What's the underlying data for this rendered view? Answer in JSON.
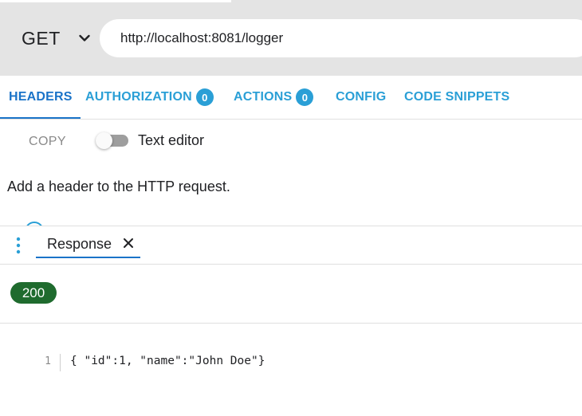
{
  "request": {
    "method": "GET",
    "url": "http://localhost:8081/logger"
  },
  "tabs": [
    {
      "label": "HEADERS",
      "active": true
    },
    {
      "label": "AUTHORIZATION",
      "badge": "0"
    },
    {
      "label": "ACTIONS",
      "badge": "0"
    },
    {
      "label": "CONFIG"
    },
    {
      "label": "CODE SNIPPETS"
    }
  ],
  "headers_panel": {
    "copy_label": "COPY",
    "text_editor_label": "Text editor",
    "text_editor_on": false,
    "hint": "Add a header to the HTTP request."
  },
  "response": {
    "tab_label": "Response",
    "status": "200",
    "line_number": "1",
    "body": "{ \"id\":1, \"name\":\"John Doe\"}"
  },
  "colors": {
    "accent": "#2a9fd6",
    "active_tab": "#1a73c8",
    "status_ok": "#1f6b2e",
    "request_bar_bg": "#e4e4e4"
  },
  "icons": {
    "method_dropdown": "chevron-down-icon",
    "response_menu": "kebab-menu-icon",
    "response_close": "close-icon"
  }
}
